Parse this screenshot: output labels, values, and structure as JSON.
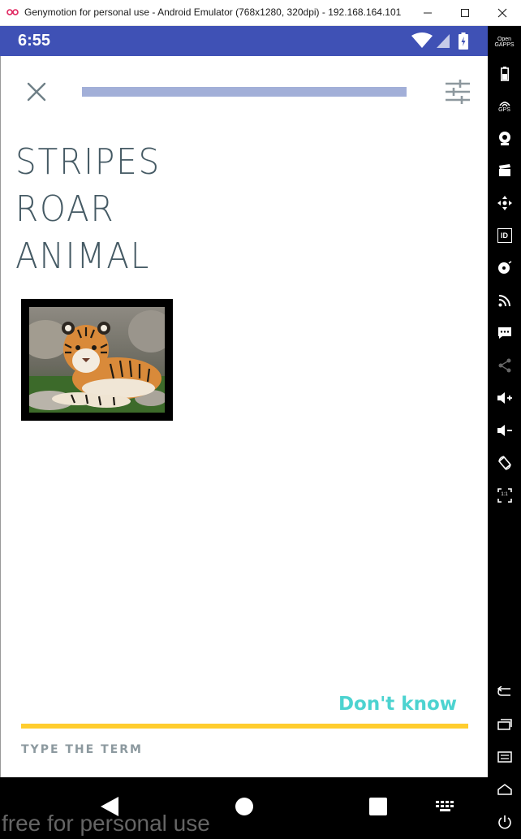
{
  "window": {
    "title": "Genymotion for personal use - Android Emulator (768x1280, 320dpi) - 192.168.164.101",
    "watermark": "free for personal use"
  },
  "status_bar": {
    "time": "6:55",
    "color": "#3f51b5",
    "icons": [
      "wifi-icon",
      "signal-icon",
      "battery-icon"
    ]
  },
  "learn": {
    "progress": 1.0,
    "terms": [
      "STRIPES",
      "ROAR",
      "ANIMAL"
    ],
    "image_subject": "tiger-cub",
    "dont_know_label": "Don't know",
    "answer_placeholder": "TYPE THE TERM",
    "colors": {
      "term_text": "#455a64",
      "progress": "#a2afd8",
      "dont_know": "#4cd3d0",
      "answer_line": "#ffcd2e"
    }
  },
  "sidebar": {
    "open_gapps_label": "Open GAPPS",
    "gps_label": "GPS",
    "id_label": "ID",
    "aspect_label": "1:1"
  },
  "nav_bar": {
    "icons": [
      "back-icon",
      "home-icon",
      "recents-icon",
      "keyboard-icon"
    ]
  }
}
